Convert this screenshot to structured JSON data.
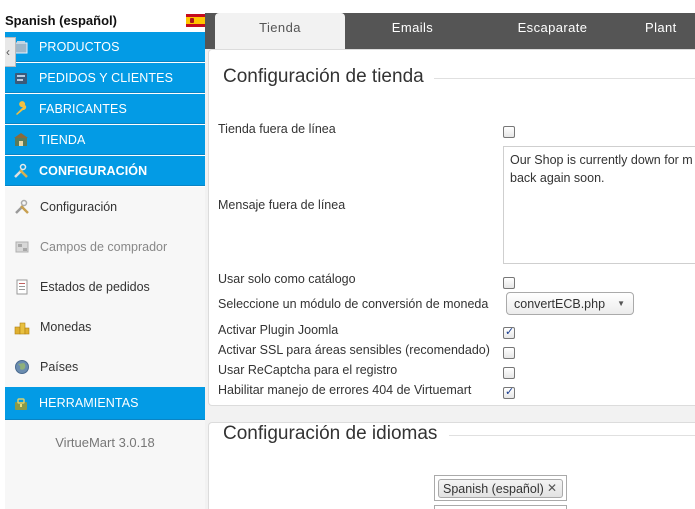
{
  "sidebar": {
    "language": "Spanish (español)",
    "menu": [
      {
        "label": "PRODUCTOS",
        "icon": "box-icon"
      },
      {
        "label": "PEDIDOS Y CLIENTES",
        "icon": "orders-icon"
      },
      {
        "label": "FABRICANTES",
        "icon": "wrench-icon"
      },
      {
        "label": "TIENDA",
        "icon": "store-icon"
      },
      {
        "label": "CONFIGURACIÓN",
        "icon": "config-icon"
      }
    ],
    "submenu": [
      {
        "label": "Configuración",
        "icon": "tools-icon"
      },
      {
        "label": "Campos de comprador",
        "icon": "fields-icon"
      },
      {
        "label": "Estados de pedidos",
        "icon": "document-icon"
      },
      {
        "label": "Monedas",
        "icon": "coins-icon"
      },
      {
        "label": "Países",
        "icon": "globe-icon"
      }
    ],
    "tools": {
      "label": "HERRAMIENTAS",
      "icon": "tools-icon"
    },
    "version": "VirtueMart 3.0.18"
  },
  "tabs": [
    "Tienda",
    "Emails",
    "Escaparate",
    "Plant"
  ],
  "shop_config": {
    "legend": "Configuración de tienda",
    "offline_label": "Tienda fuera de línea",
    "offline_msg_label": "Mensaje fuera de línea",
    "offline_msg_value": "Our Shop is currently down for m back again soon.",
    "catalog_label": "Usar solo como catálogo",
    "currency_module_label": "Seleccione un módulo de conversión de moneda",
    "currency_module_value": "convertECB.php",
    "joomla_plugin_label": "Activar Plugin Joomla",
    "ssl_label": "Activar SSL para áreas sensibles (recomendado)",
    "recaptcha_label": "Usar ReCaptcha para el registro",
    "error404_label": "Habilitar manejo de errores 404 de Virtuemart"
  },
  "lang_config": {
    "legend": "Configuración de idiomas",
    "selected_language": "Spanish (español)"
  },
  "checks": {
    "offline": false,
    "catalog": false,
    "joomla_plugin": true,
    "ssl": false,
    "recaptcha": false,
    "error404": true
  },
  "colors": {
    "menu_blue": "#039be5",
    "tab_bar": "#555555",
    "content_bg": "#f2f2f2"
  }
}
